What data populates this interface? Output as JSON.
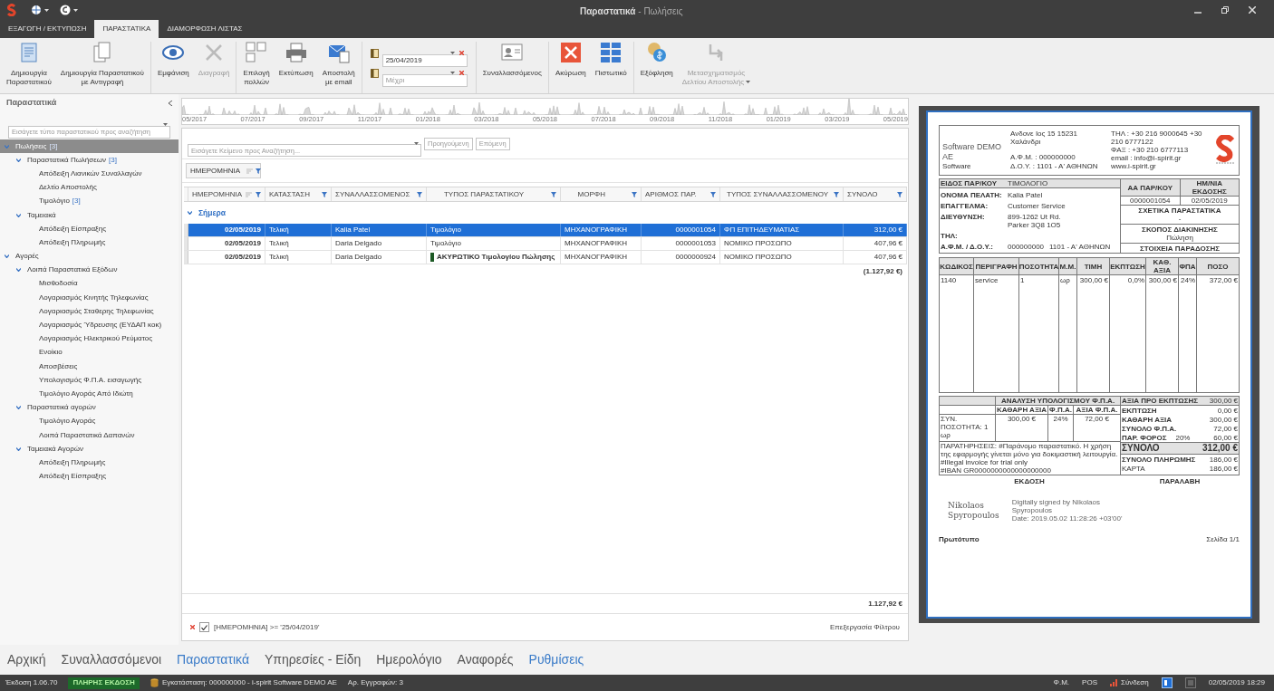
{
  "window": {
    "title": "**Παραστατικά** - Πωλήσεις"
  },
  "ribbon_tabs": [
    {
      "label": "ΕΞΑΓΩΓΗ / ΕΚΤΥΠΩΣΗ",
      "selected": false
    },
    {
      "label": "ΠΑΡΑΣΤΑΤΙΚΑ",
      "selected": true
    },
    {
      "label": "ΔΙΑΜΟΡΦΩΣΗ ΛΙΣΤΑΣ",
      "selected": false
    }
  ],
  "ribbon_groups": [
    {
      "kind": "buttons",
      "buttons": [
        {
          "lines": [
            "Δημιουργία",
            "Παραστατικού"
          ],
          "disabled": false,
          "dropdown": false
        },
        {
          "lines": [
            "Δημιουργία Παραστατικού",
            "με Αντιγραφή"
          ],
          "disabled": false,
          "dropdown": false
        }
      ]
    },
    {
      "kind": "buttons",
      "buttons": [
        {
          "lines": [
            "Εμφάνιση"
          ],
          "disabled": false,
          "dropdown": false
        },
        {
          "lines": [
            "Διαγραφή"
          ],
          "disabled": true,
          "dropdown": false
        }
      ]
    },
    {
      "kind": "buttons",
      "buttons": [
        {
          "lines": [
            "Επιλογή",
            "πολλών"
          ],
          "disabled": false,
          "dropdown": false
        },
        {
          "lines": [
            "Εκτύπωση"
          ],
          "disabled": false,
          "dropdown": false
        },
        {
          "lines": [
            "Αποστολή",
            "με email"
          ],
          "disabled": false,
          "dropdown": false
        }
      ]
    },
    {
      "kind": "dates",
      "fields": [
        {
          "value": "25/04/2019"
        },
        {
          "placeholder": "Μέχρι"
        }
      ]
    },
    {
      "kind": "buttons",
      "buttons": [
        {
          "lines": [
            "Συναλλασσόμενος"
          ],
          "disabled": false,
          "dropdown": false
        }
      ]
    },
    {
      "kind": "buttons",
      "buttons": [
        {
          "lines": [
            "Ακύρωση"
          ],
          "disabled": false,
          "dropdown": false
        },
        {
          "lines": [
            "Πιστωτικό"
          ],
          "disabled": false,
          "dropdown": false
        }
      ]
    },
    {
      "kind": "buttons",
      "buttons": [
        {
          "lines": [
            "Εξόφληση"
          ],
          "disabled": false,
          "dropdown": false
        },
        {
          "lines": [
            "Μετασχηματισμός",
            "Δελτίου Αποστολής"
          ],
          "disabled": true,
          "dropdown": true
        }
      ]
    }
  ],
  "sidebar": {
    "title": "Παραστατικά",
    "search_placeholder": "Εισάγετε τύπο παραστατικού προς αναζήτηση",
    "tree": [
      {
        "label": "Πωλήσεις",
        "count": "[3]",
        "selected": true,
        "expanded": true,
        "children": [
          {
            "label": "Παραστατικά Πωλήσεων",
            "count": "[3]",
            "selected": false,
            "expanded": true,
            "children": [
              {
                "label": "Απόδειξη Λιανικών Συναλλαγών",
                "selected": false
              },
              {
                "label": "Δελτίο Αποστολής",
                "selected": false
              },
              {
                "label": "Τιμολόγιο",
                "count": "[3]",
                "selected": false
              }
            ]
          },
          {
            "label": "Ταμειακά",
            "selected": false,
            "expanded": true,
            "children": [
              {
                "label": "Απόδειξη Είσπραξης",
                "selected": false
              },
              {
                "label": "Απόδειξη Πληρωμής",
                "selected": false
              }
            ]
          }
        ]
      },
      {
        "label": "Αγορές",
        "selected": false,
        "expanded": true,
        "children": [
          {
            "label": "Λοιπά Παραστατικά Εξόδων",
            "selected": false,
            "expanded": true,
            "children": [
              {
                "label": "Μισθοδοσία",
                "selected": false
              },
              {
                "label": "Λογαριασμός  Κινητής Τηλεφωνίας",
                "selected": false
              },
              {
                "label": "Λογαριασμός  Σταθερης Τηλεφωνίας",
                "selected": false
              },
              {
                "label": "Λογαριασμός Ύδρευσης (ΕΥΔΑΠ κοκ)",
                "selected": false
              },
              {
                "label": "Λογαριασμός  Ηλεκτρικού Ρεύματος",
                "selected": false
              },
              {
                "label": "Ενοίκιο",
                "selected": false
              },
              {
                "label": "Αποσβέσεις",
                "selected": false
              },
              {
                "label": "Υπολογισμός Φ.Π.Α. εισαγωγής",
                "selected": false
              },
              {
                "label": "Τιμολόγιο Αγοράς Από Ιδιώτη",
                "selected": false
              }
            ]
          },
          {
            "label": "Παραστατικά αγορών",
            "selected": false,
            "expanded": true,
            "children": [
              {
                "label": "Τιμολόγιο Αγοράς",
                "selected": false
              },
              {
                "label": "Λοιπά Παραστατικά Δαπανών",
                "selected": false
              }
            ]
          },
          {
            "label": "Ταμειακά Αγορών",
            "selected": false,
            "expanded": true,
            "children": [
              {
                "label": "Απόδειξη Πληρωμής",
                "selected": false
              },
              {
                "label": "Απόδειξη Είσπραξης",
                "selected": false
              }
            ]
          }
        ]
      }
    ]
  },
  "timeline": {
    "labels": [
      "05/2017",
      "07/2017",
      "09/2017",
      "11/2017",
      "01/2018",
      "03/2018",
      "05/2018",
      "07/2018",
      "09/2018",
      "11/2018",
      "01/2019",
      "03/2019",
      "05/2019"
    ]
  },
  "search": {
    "placeholder": "Εισάγετε Κείμενο προς Αναζήτηση...",
    "buttons": [
      "Προηγούμενη",
      "Επόμενη"
    ]
  },
  "group_panel": {
    "chips": [
      "ΗΜΕΡΟΜΗΝΙΑ"
    ]
  },
  "table": {
    "columns": [
      "ΗΜΕΡΟΜΗΝΙΑ",
      "ΚΑΤΑΣΤΑΣΗ",
      "ΣΥΝΑΛΛΑΣΣΟΜΕΝΟΣ",
      "ΤΥΠΟΣ ΠΑΡΑΣΤΑΤΙΚΟΥ",
      "ΜΟΡΦΗ",
      "ΑΡΙΘΜΟΣ ΠΑΡ.",
      "ΤΥΠΟΣ ΣΥΝΑΛΛΑΣΣΟΜΕΝΟΥ",
      "ΣΥΝΟΛΟ"
    ],
    "group": {
      "label": "Σήμερα",
      "expanded": true
    },
    "rows": [
      {
        "selected": true,
        "marked": false,
        "cells": [
          "02/05/2019",
          "Τελική",
          "Kalia Patel",
          "Τιμολόγιο",
          "ΜΗΧΑΝΟΓΡΑΦΙΚΗ",
          "0000001054",
          "ΦΠ ΕΠΙΤΗΔΕΥΜΑΤΙΑΣ",
          "312,00 €"
        ]
      },
      {
        "selected": false,
        "marked": false,
        "cells": [
          "02/05/2019",
          "Τελική",
          "Daria Delgado",
          "Τιμολόγιο",
          "ΜΗΧΑΝΟΓΡΑΦΙΚΗ",
          "0000001053",
          "ΝΟΜΙΚΟ ΠΡΟΣΩΠΟ",
          "407,96 €"
        ]
      },
      {
        "selected": false,
        "marked": true,
        "cells": [
          "02/05/2019",
          "Τελική",
          "Daria Delgado",
          "ΑΚΥΡΩΤΙΚΟ Τιμολογίου Πώλησης",
          "ΜΗΧΑΝΟΓΡΑΦΙΚΗ",
          "0000000924",
          "ΝΟΜΙΚΟ ΠΡΟΣΩΠΟ",
          "407,96 €"
        ]
      }
    ],
    "group_total": "(1.127,92 €)",
    "footer_total": "1.127,92 €"
  },
  "filter": {
    "enabled": true,
    "text": "[ΗΜΕΡΟΜΗΝΙΑ] >= '25/04/2019'",
    "edit_link": "Επεξεργασία Φίλτρου"
  },
  "document": {
    "company": "Software DEMO AE",
    "company_sub": "Software",
    "address": [
      "Ανδονε Ιος 15 15231",
      "Χαλάνδρι"
    ],
    "tax": [
      "Α.Φ.Μ. : 000000000",
      "Δ.Ο.Υ. : 1101 - Α' ΑΘΗΝΩΝ"
    ],
    "contact": [
      "ΤΗΛ : +30 216 9000645 +30",
      "210 6777122",
      "ΦΑΞ : +30 210 6777113",
      "email : info@i-spirit.gr",
      "www.i-spirit.gr"
    ],
    "doc_type": {
      "label": "ΕΙΔΟΣ ΠΑΡ/ΚΟΥ",
      "value": "ΤΙΜΟΛΟΓΙΟ"
    },
    "customer": [
      {
        "label": "ΟΝΟΜΑ ΠΕΛΑΤΗ:",
        "value": "Kalia Patel"
      },
      {
        "label": "ΕΠΑΓΓΕΛΜΑ:",
        "value": "Customer Service"
      },
      {
        "label": "ΔΙΕΥΘΥΝΣΗ:",
        "value": "899-1262 Ut Rd. Parker 3Q8 1O5"
      },
      {
        "label": "ΤΗΛ:"
      },
      {
        "label": "Α.Φ.Μ. / Δ.Ο.Υ.:",
        "value": "000000000",
        "value2": "1101 - Α' ΑΘΗΝΩΝ"
      }
    ],
    "ids": [
      {
        "label": "ΑΑ ΠΑΡ/ΚΟΥ",
        "value": "0000001054"
      },
      {
        "label": "ΗΜ/ΝΙΑ ΕΚΔΟΣΗΣ",
        "value": "02/05/2019"
      }
    ],
    "sections": [
      {
        "label": "ΣΧΕΤΙΚΑ ΠΑΡΑΣΤΑΤΙΚΑ",
        "value": "-"
      },
      {
        "label": "ΣΚΟΠΟΣ ΔΙΑΚΙΝΗΣΗΣ",
        "value": "Πώληση"
      },
      {
        "label": "ΣΤΟΙΧΕΙΑ ΠΑΡΑΔΟΣΗΣ"
      }
    ],
    "item_columns": [
      "ΚΩΔΙΚΟΣ",
      "ΠΕΡΙΓΡΑΦΗ",
      "ΠΟΣΟΤΗΤΑ",
      "Μ.Μ.",
      "ΤΙΜΗ",
      "ΕΚΠΤΩΣΗ",
      "ΚΑΘ. ΑΞΙΑ",
      "ΦΠΑ",
      "ΠΟΣΟ"
    ],
    "items": [
      [
        "1140",
        "service",
        "1",
        "ωρ",
        "300,00 €",
        "0,0%",
        "300,00 €",
        "24%",
        "372,00 €"
      ]
    ],
    "vat_title": "ΑΝΑΛΥΣΗ ΥΠΟΛΟΓΙΣΜΟΥ Φ.Π.Α.",
    "vat_columns": [
      "ΚΑΘΑΡΗ ΑΞΙΑ",
      "Φ.Π.Α.",
      "ΑΞΙΑ Φ.Π.Α."
    ],
    "vat_quantity": "ΣΥΝ. ΠΟΣΟΤΗΤΑ: 1 ωρ",
    "vat_row": [
      "300,00 €",
      "24%",
      "72,00 €"
    ],
    "totals": [
      {
        "kind": "line",
        "label": "ΑΞΙΑ ΠΡΟ ΕΚΠΤΩΣΗΣ",
        "value": "300,00 €"
      },
      {
        "kind": "line",
        "label": "ΕΚΠΤΩΣΗ",
        "value": "0,00 €"
      },
      {
        "kind": "line",
        "label": "ΚΑΘΑΡΗ ΑΞΙΑ",
        "value": "300,00 €"
      },
      {
        "kind": "line",
        "label": "ΣΥΝΟΛΟ Φ.Π.Α.",
        "value": "72,00 €"
      },
      {
        "kind": "line",
        "label": "ΠΑΡ. ΦΟΡΟΣ",
        "rate": "20%",
        "value": "60,00 €"
      },
      {
        "kind": "grand",
        "label": "ΣΥΝΟΛΟ",
        "value": "312,00 €"
      },
      {
        "kind": "line",
        "label": "ΣΥΝΟΛΟ ΠΛΗΡΩΜΗΣ",
        "value": "186,00 €"
      },
      {
        "kind": "plain",
        "label": "ΚΑΡΤΑ",
        "value": "186,00 €"
      }
    ],
    "notes": "ΠΑΡΑΤΗΡΗΣΕΙΣ: #Παράνομο παραστατικό. Η χρήση της εφαρμογής γίνεται μόνο για δοκιμαστική λειτουργία.\n#Illegal invoice for trial only\n#IBAN GR0000000000000000000",
    "sign_labels": [
      "ΕΚΔΟΣΗ",
      "ΠΑΡΑΛΑΒΗ"
    ],
    "signer": [
      "Nikolaos",
      "Spyropoulos"
    ],
    "signature_note": [
      "Digitally signed by Nikolaos",
      "Spyropoulos",
      "Date: 2019.05.02 11:28:26 +03'00'"
    ],
    "footer_left": "Πρωτότυπο",
    "footer_right": "Σελίδα 1/1"
  },
  "nav": [
    {
      "label": "Αρχική",
      "highlighted": false
    },
    {
      "label": "Συναλλασσόμενοι",
      "highlighted": false
    },
    {
      "label": "Παραστατικά",
      "highlighted": true
    },
    {
      "label": "Υπηρεσίες - Είδη",
      "highlighted": false
    },
    {
      "label": "Ημερολόγιο",
      "highlighted": false
    },
    {
      "label": "Αναφορές",
      "highlighted": false
    },
    {
      "label": "Ρυθμίσεις",
      "highlighted": true
    }
  ],
  "status_bar": {
    "version": "Έκδοση 1.06.70",
    "edition": "ΠΛΗΡΗΣ ΕΚΔΟΣΗ",
    "installation": "Εγκατάσταση: 000000000 - i-spirit Software DEMO AE",
    "records": "Αρ. Εγγραφών: 3",
    "right": [
      "Φ.Μ.",
      "POS"
    ],
    "connection": "Σύνδεση",
    "datetime": "02/05/2019 18:29"
  }
}
